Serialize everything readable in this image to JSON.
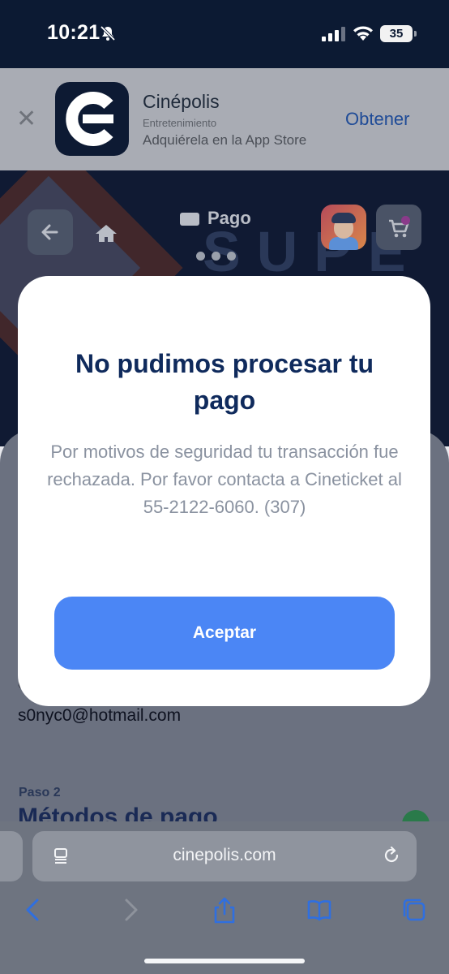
{
  "status_bar": {
    "time": "10:21",
    "battery": "35"
  },
  "banner": {
    "app_name": "Cinépolis",
    "category": "Entretenimiento",
    "subtitle": "Adquiérela en la App Store",
    "get_label": "Obtener",
    "close_glyph": "✕"
  },
  "page": {
    "title": "Pago",
    "email_label": "C",
    "email": "s0nyc0@hotmail.com",
    "step_label": "Paso 2",
    "step_title": "Métodos de pago",
    "hero_text": "SUPE"
  },
  "modal": {
    "title": "No pudimos procesar tu pago",
    "message": "Por motivos de seguridad tu transacción fue rechazada. Por favor contacta a Cineticket al 55-2122-6060. (307)",
    "button": "Aceptar"
  },
  "safari": {
    "url": "cinepolis.com"
  },
  "colors": {
    "accent": "#4b86f5",
    "title": "#0f2a5c",
    "brand_dark": "#0d1a33"
  }
}
